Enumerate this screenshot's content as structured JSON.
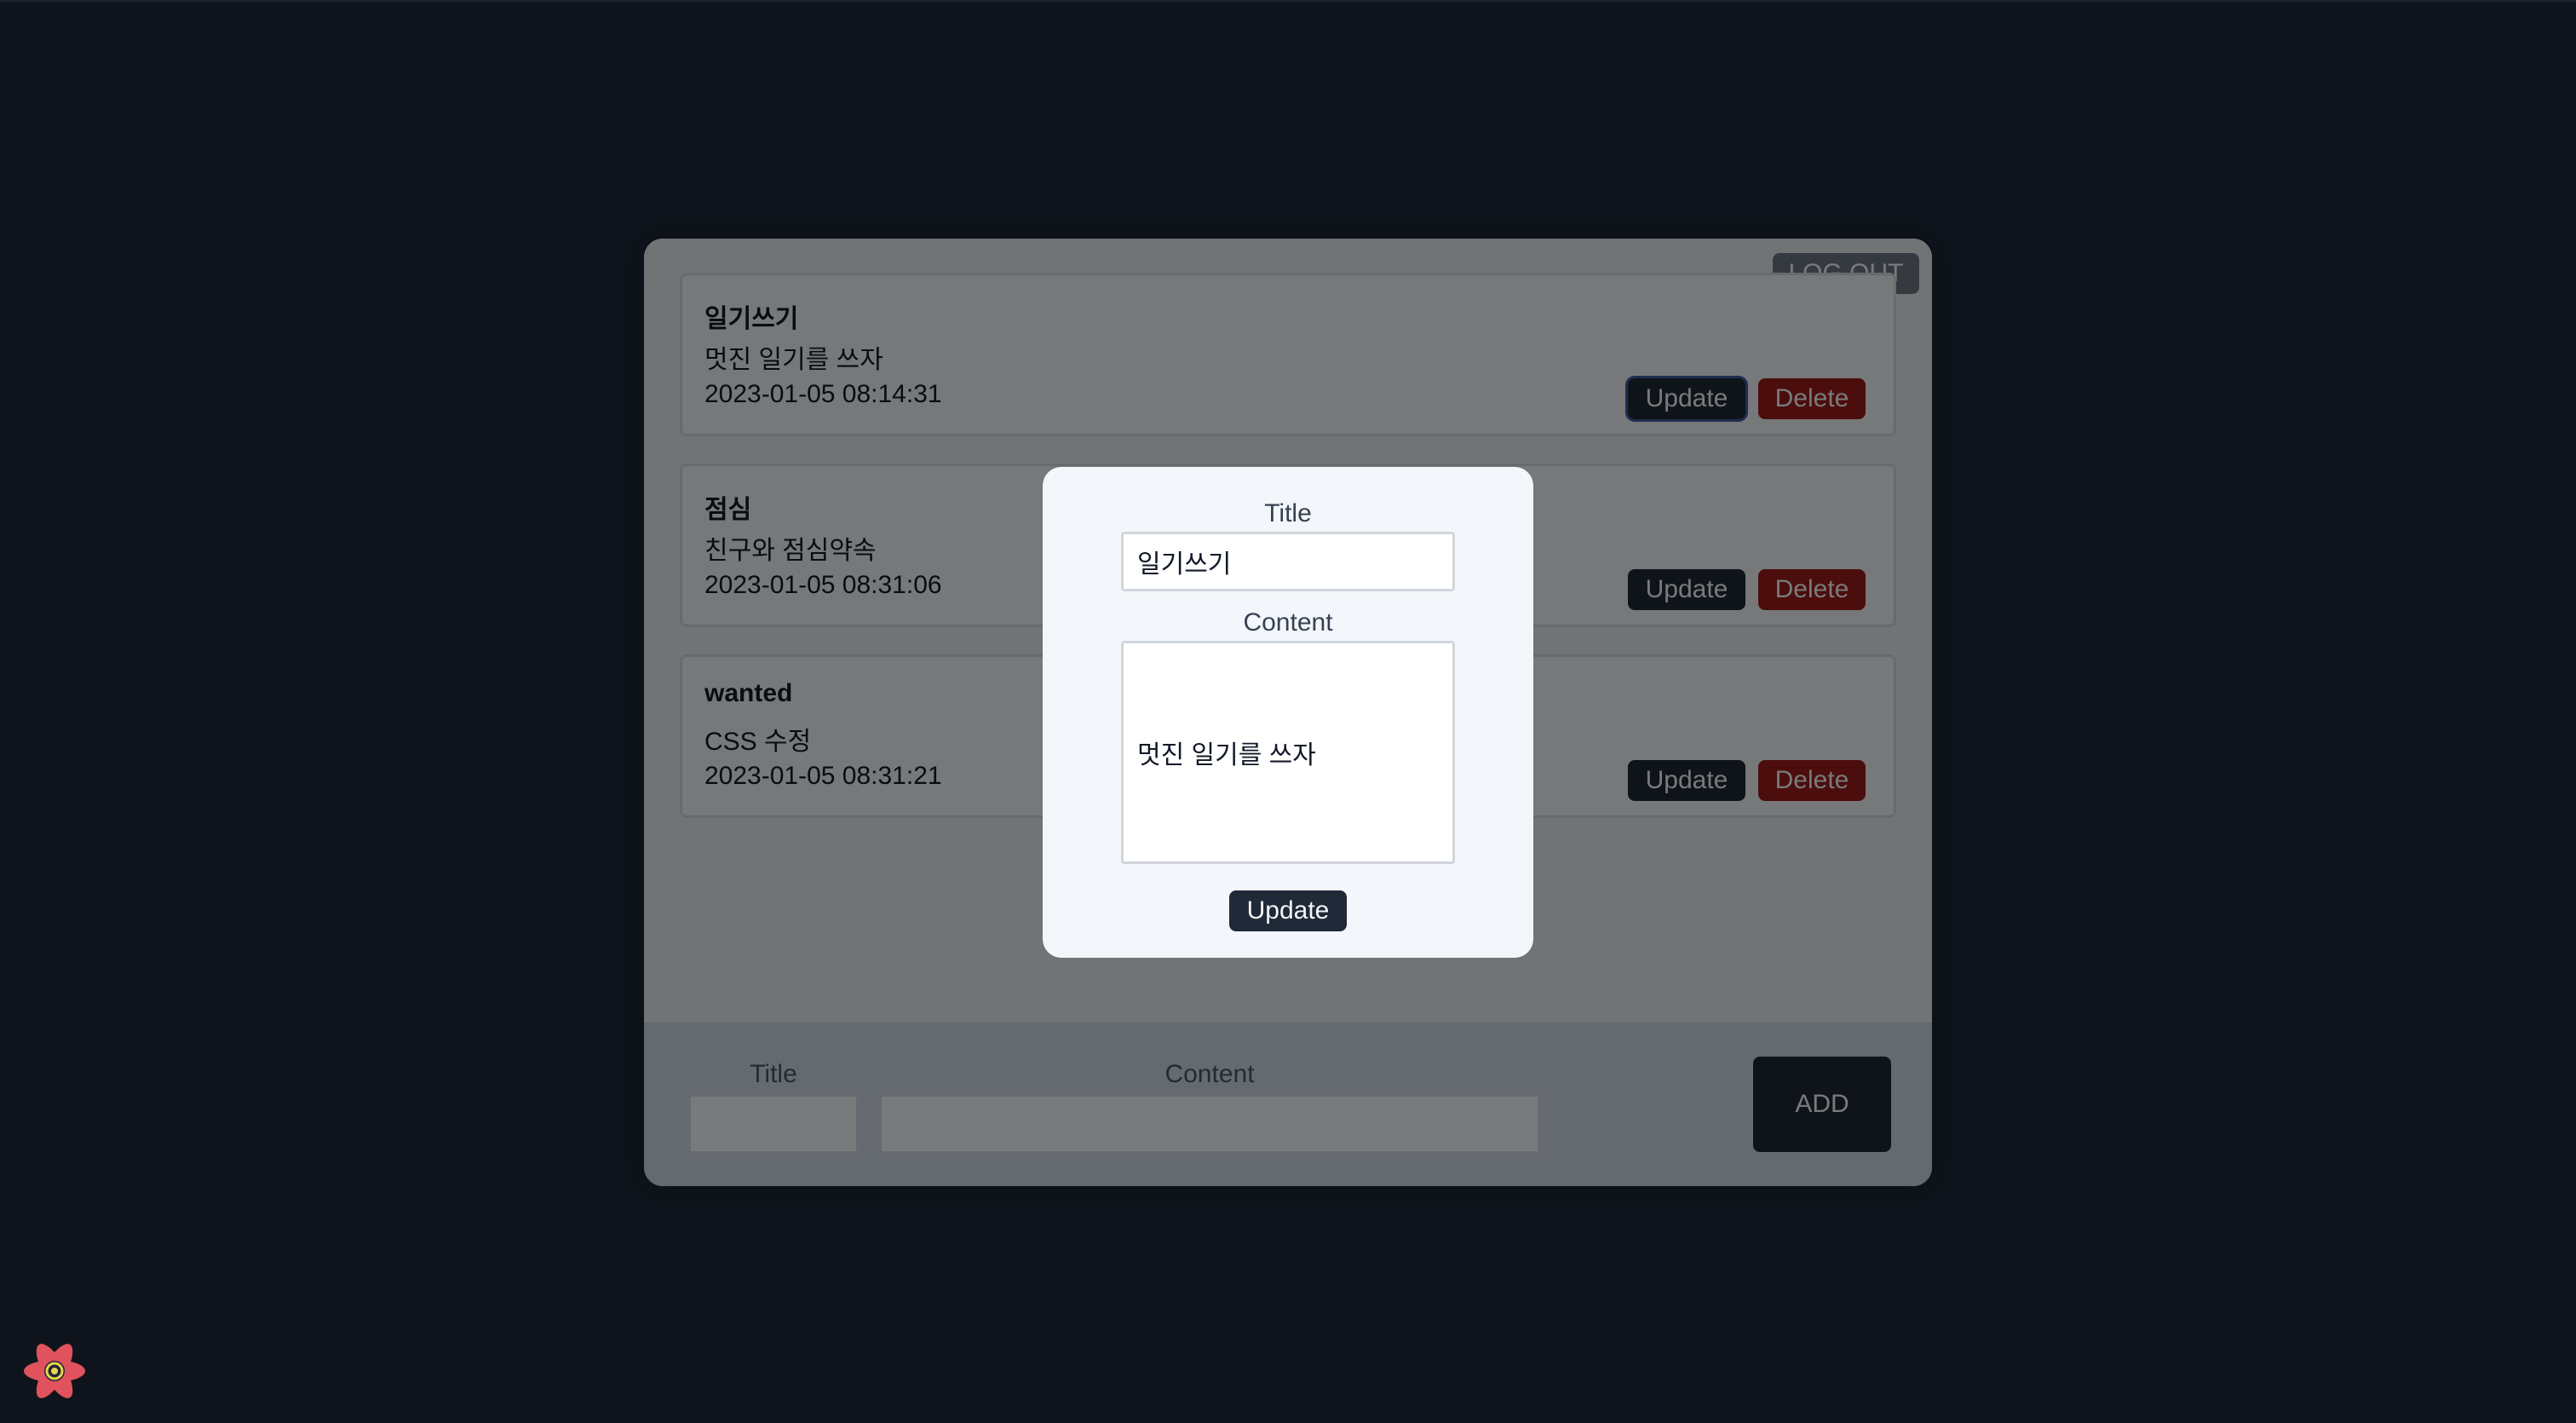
{
  "header": {
    "logout_label": "LOG OUT"
  },
  "todos": [
    {
      "title": "일기쓰기",
      "content": "멋진 일기를 쓰자",
      "date": "2023-01-05 08:14:31",
      "update_label": "Update",
      "delete_label": "Delete"
    },
    {
      "title": "점심",
      "content": "친구와 점심약속",
      "date": "2023-01-05 08:31:06",
      "update_label": "Update",
      "delete_label": "Delete"
    },
    {
      "title": "wanted",
      "content": "CSS 수정",
      "date": "2023-01-05 08:31:21",
      "update_label": "Update",
      "delete_label": "Delete"
    }
  ],
  "add_form": {
    "title_label": "Title",
    "content_label": "Content",
    "title_value": "",
    "content_value": "",
    "add_label": "ADD"
  },
  "modal": {
    "title_label": "Title",
    "title_value": "일기쓰기",
    "content_label": "Content",
    "content_value": "멋진 일기를 쓰자",
    "update_label": "Update"
  },
  "icons": {
    "devtools": "react-devtools-icon"
  },
  "colors": {
    "background": "#1f2838",
    "update_button": "#1f2937",
    "delete_button": "#991b1b",
    "overlay": "rgba(0,0,0,0.5)"
  }
}
